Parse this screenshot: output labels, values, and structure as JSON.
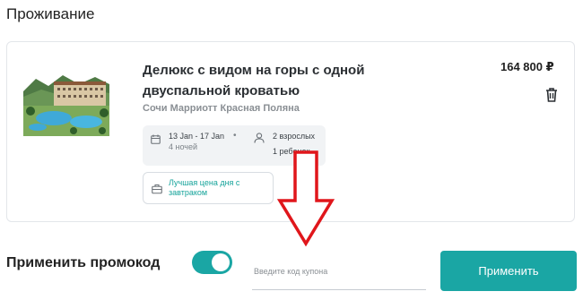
{
  "section": {
    "title": "Проживание"
  },
  "booking": {
    "room_title": "Делюкс с видом на горы с одной двуспальной кроватью",
    "hotel_name": "Сочи Марриотт Красная Поляна",
    "price": "164 800 ₽",
    "dates": "13 Jan - 17 Jan",
    "dot": "•",
    "nights": "4 ночей",
    "adults": "2 взрослых",
    "children": "1 ребенок",
    "offer": "Лучшая цена дня с завтраком"
  },
  "promo": {
    "label": "Применить промокод",
    "toggle_on": true,
    "coupon_placeholder": "Введите код купона",
    "coupon_value": "",
    "apply_label": "Применить"
  },
  "icons": {
    "calendar": "calendar-icon",
    "guests": "person-icon",
    "offer": "briefcase-icon",
    "delete": "trash-icon"
  },
  "colors": {
    "accent": "#1aa6a4",
    "offer_text": "#15a39a",
    "annotation_arrow": "#e0161b"
  }
}
